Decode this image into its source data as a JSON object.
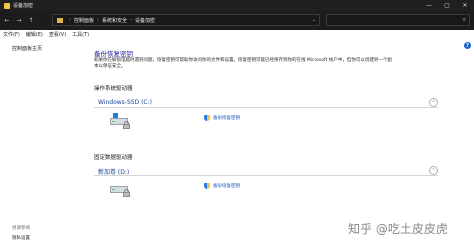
{
  "window": {
    "title": "设备加密",
    "controls": [
      "—",
      "▢",
      "✕"
    ]
  },
  "address": {
    "back": "←",
    "forward": "→",
    "up": "↑",
    "crumbs": [
      "控制面板",
      "系统和安全",
      "设备加密"
    ],
    "refresh": "↻",
    "search_icon": "search-icon"
  },
  "menu": {
    "items": [
      "文件(F)",
      "编辑(E)",
      "查看(V)",
      "工具(T)"
    ]
  },
  "sidebar": {
    "home": "控制面板主页",
    "see_also": "另请参阅",
    "bitlocker": "隐私设置"
  },
  "main": {
    "heading": "备份恢复密钥",
    "description": "如果你在解锁电脑时遇到问题，恢复密钥可帮助你访问你的文件和设置。恢复密钥可能已经保存到你的在线 Microsoft 帐户中，但你可以创建另一个副本以保证安全。",
    "os_section": "操作系统驱动器",
    "fixed_section": "固定数据驱动器",
    "os_drive": {
      "name": "Windows-SSD (C:)",
      "link": "备份恢复密钥"
    },
    "fixed_drive": {
      "name": "新加卷 (D:)",
      "link": "备份恢复密钥"
    }
  },
  "watermark": "知乎 @吃土皮皮虎",
  "colors": {
    "titlebar": "#202020",
    "link": "#1a4fb0",
    "heading": "#1b1b9a"
  }
}
